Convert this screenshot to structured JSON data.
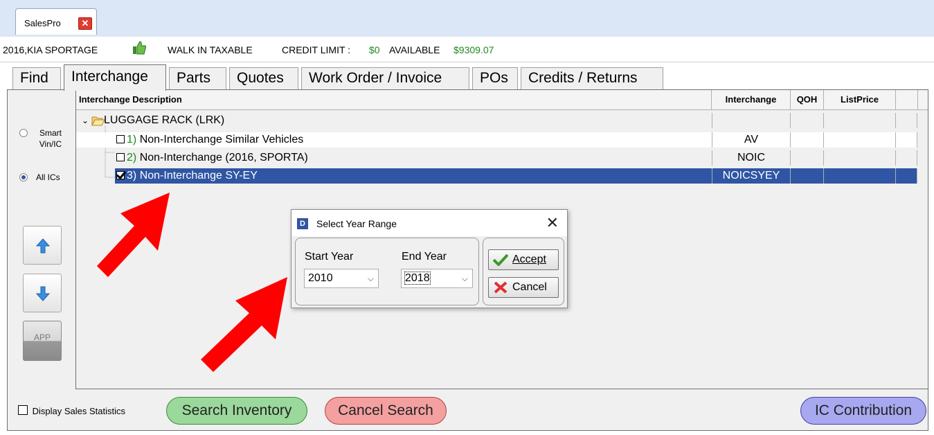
{
  "window": {
    "doc_tab_label": "SalesPro",
    "close_glyph": "✕"
  },
  "info": {
    "vehicle": "2016,KIA SPORTAGE",
    "customer_type": "WALK IN TAXABLE",
    "credit_limit_label": "CREDIT LIMIT :",
    "credit_limit_value": "$0",
    "available_label": "AVAILABLE",
    "available_value": "$9309.07"
  },
  "tabs": [
    {
      "label": "Find",
      "active": false
    },
    {
      "label": "Interchange",
      "active": true
    },
    {
      "label": "Parts",
      "active": false
    },
    {
      "label": "Quotes",
      "active": false
    },
    {
      "label": "Work Order / Invoice",
      "active": false
    },
    {
      "label": "POs",
      "active": false
    },
    {
      "label": "Credits / Returns",
      "active": false
    }
  ],
  "left_options": {
    "smart_vin_ic": "Smart Vin/IC",
    "all_ics": "All ICs",
    "selected": "all_ics",
    "app_button": "APP"
  },
  "grid": {
    "columns": [
      "Interchange Description",
      "Interchange",
      "QOH",
      "ListPrice"
    ],
    "group": {
      "label": "LUGGAGE RACK (LRK)",
      "expanded": true,
      "icon": "folder-open-icon"
    },
    "rows": [
      {
        "num": "1)",
        "desc": "Non-Interchange Similar Vehicles",
        "interchange": "AV",
        "qoh": "",
        "list_price": "",
        "checked": false,
        "selected": false
      },
      {
        "num": "2)",
        "desc": "Non-Interchange (2016, SPORTA)",
        "interchange": "NOIC",
        "qoh": "",
        "list_price": "",
        "checked": false,
        "selected": false
      },
      {
        "num": "3)",
        "desc": "Non-Interchange SY-EY",
        "interchange": "NOICSYEY",
        "qoh": "",
        "list_price": "",
        "checked": true,
        "selected": true
      }
    ]
  },
  "dialog": {
    "title": "Select Year Range",
    "start_year_label": "Start Year",
    "start_year_value": "2010",
    "end_year_label": "End Year",
    "end_year_value": "2018",
    "accept_label": "Accept",
    "cancel_label": "Cancel"
  },
  "bottom": {
    "display_sales_statistics": "Display Sales Statistics",
    "search_inventory": "Search Inventory",
    "cancel_search": "Cancel Search",
    "ic_contribution": "IC Contribution"
  },
  "colors": {
    "selection": "#2f55a4",
    "green_pill": "#9bd89b",
    "red_pill": "#f4a0a0",
    "blue_pill": "#a8a8f0",
    "annotation_arrow": "#ff0000"
  }
}
